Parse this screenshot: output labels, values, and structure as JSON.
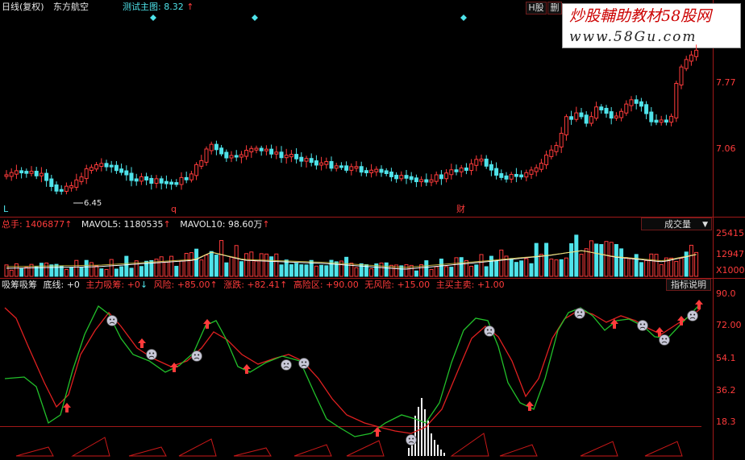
{
  "header": {
    "period": "日线(复权)",
    "stock_name": "东方航空",
    "indicator": "测试主图: 8.32",
    "buttons": [
      "H股",
      "删"
    ]
  },
  "watermark": {
    "title": "炒股輔助教材58股网",
    "url": "www.58Gu.com"
  },
  "price_pane": {
    "y_labels": [
      "7.77",
      "7.06"
    ],
    "low_label": "6.45",
    "markers": [
      "L",
      "q",
      "财"
    ]
  },
  "volume_pane": {
    "legend": [
      {
        "label": "总手: 1406877",
        "arrow": "↑"
      },
      {
        "label": "MAVOL5: 1180535",
        "arrow": "↑"
      },
      {
        "label": "MAVOL10: 98.60万",
        "arrow": "↑"
      }
    ],
    "selector": "成交量",
    "y_labels": [
      "25415",
      "12947",
      "X1000"
    ]
  },
  "indicator_pane": {
    "name": "吸筹吸筹",
    "base": "底线: +0",
    "params": [
      {
        "label": "主力吸筹: +0",
        "arrow": "↓"
      },
      {
        "label": "风险: +85.00",
        "arrow": "↑"
      },
      {
        "label": "涨跌: +82.41",
        "arrow": "↑"
      },
      {
        "label": "高险区: +90.00"
      },
      {
        "label": "无风险: +15.00"
      },
      {
        "label": "主买主卖: +1.00"
      }
    ],
    "explain_button": "指标说明",
    "y_labels": [
      "90.0",
      "72.00",
      "54.1",
      "36.2",
      "18.3"
    ]
  },
  "colors": {
    "up": "#ff3b3b",
    "down": "#4fe3ea",
    "grid": "#a01818",
    "green_line": "#22c02a",
    "red_line": "#e02020"
  }
}
